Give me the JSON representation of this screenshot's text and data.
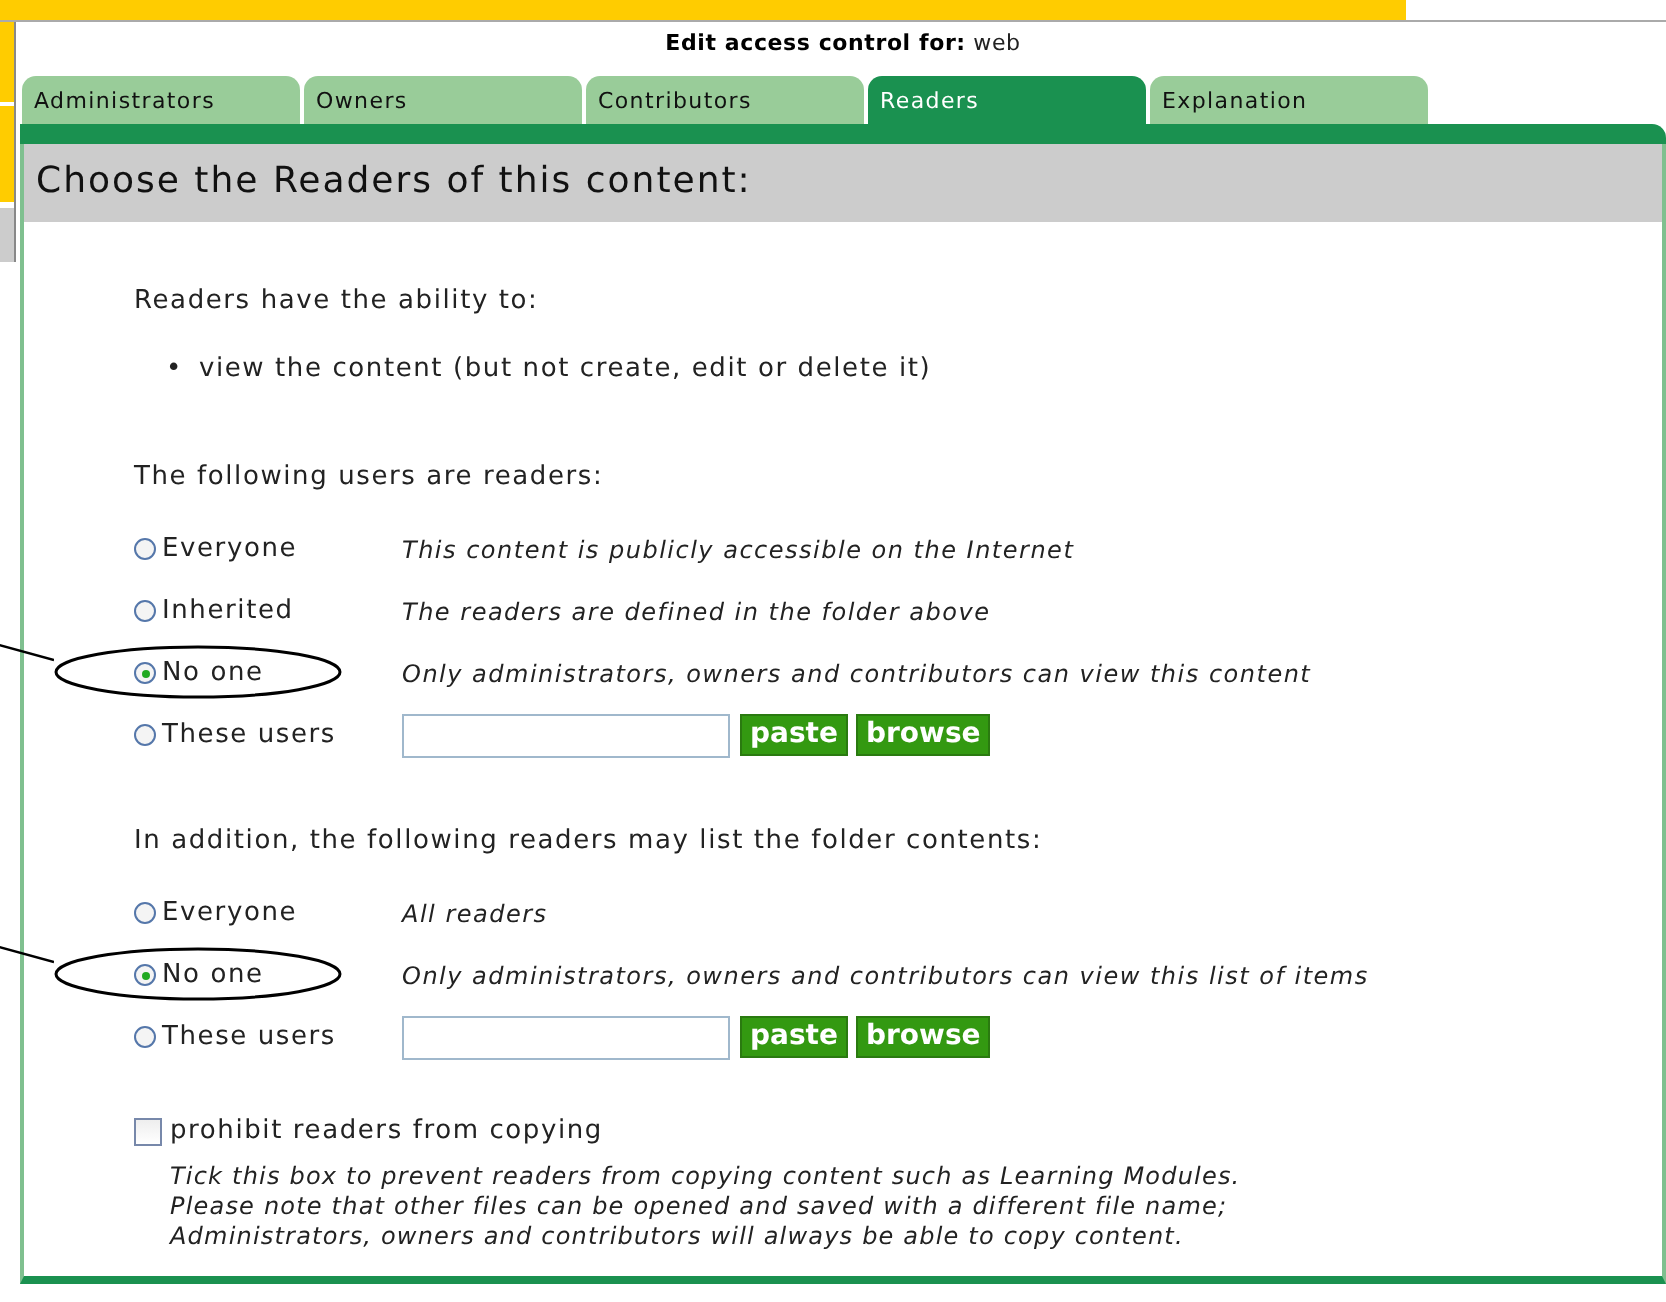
{
  "title": {
    "label": "Edit access control for:",
    "value": "web"
  },
  "tabs": [
    {
      "label": "Administrators",
      "selected": false
    },
    {
      "label": "Owners",
      "selected": false
    },
    {
      "label": "Contributors",
      "selected": false
    },
    {
      "label": "Readers",
      "selected": true
    },
    {
      "label": "Explanation",
      "selected": false
    }
  ],
  "heading": "Choose the Readers of this content:",
  "intro": "Readers have the ability to:",
  "abilities": [
    {
      "bullet": "•",
      "text": "view the content (but not create, edit or delete it)"
    }
  ],
  "groups": [
    {
      "prompt": "The following users are readers:",
      "options": [
        {
          "label": "Everyone",
          "kind": "note",
          "note": "This content is publicly accessible on the Internet",
          "selected": false,
          "circled": false
        },
        {
          "label": "Inherited",
          "kind": "note",
          "note": "The readers are defined in the folder above",
          "selected": false,
          "circled": false
        },
        {
          "label": "No one",
          "kind": "note",
          "note": "Only administrators, owners and contributors can view this content",
          "selected": true,
          "circled": true
        },
        {
          "label": "These users",
          "kind": "users",
          "buttons": [
            "paste",
            "browse"
          ],
          "selected": false,
          "circled": false
        }
      ]
    },
    {
      "prompt": "In addition, the following readers may list the folder contents:",
      "options": [
        {
          "label": "Everyone",
          "kind": "note",
          "note": "All readers",
          "selected": false,
          "circled": false
        },
        {
          "label": "No one",
          "kind": "note",
          "note": "Only administrators, owners and contributors can view this list of items",
          "selected": true,
          "circled": true
        },
        {
          "label": "These users",
          "kind": "users",
          "buttons": [
            "paste",
            "browse"
          ],
          "selected": false,
          "circled": false
        }
      ]
    }
  ],
  "prohibit": {
    "label": "prohibit readers from copying",
    "checked": false,
    "help": [
      "Tick this box to prevent readers from copying content such as Learning Modules.",
      "Please note that other files can be opened and saved with a different file name;",
      "Administrators, owners and contributors will always be able to copy content."
    ]
  }
}
